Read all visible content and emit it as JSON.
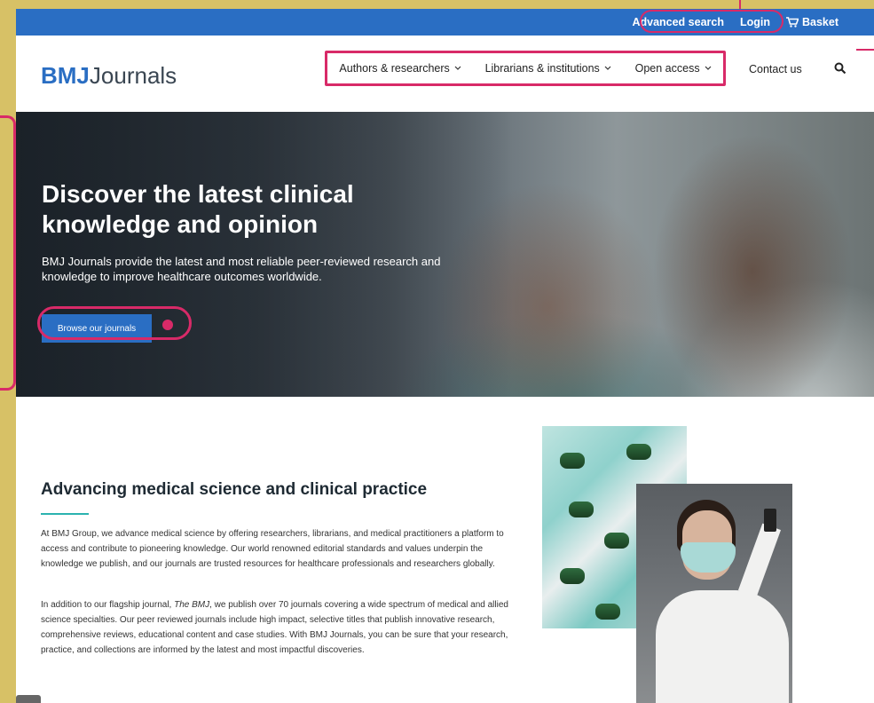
{
  "topbar": {
    "advanced_search": "Advanced search",
    "login": "Login",
    "basket": "Basket"
  },
  "header": {
    "logo_bold": "BMJ",
    "logo_rest": "Journals",
    "nav": [
      {
        "label": "Authors & researchers"
      },
      {
        "label": "Librarians & institutions"
      },
      {
        "label": "Open access"
      }
    ],
    "contact": "Contact us",
    "search_icon": "search-icon"
  },
  "hero": {
    "title": "Discover the latest clinical knowledge and opinion",
    "subtitle": "BMJ Journals provide the latest and most reliable peer-reviewed research and knowledge to improve healthcare outcomes worldwide.",
    "cta": "Browse our journals"
  },
  "section": {
    "title": "Advancing medical science and clinical practice",
    "para1": "At BMJ Group, we advance medical science by offering researchers, librarians, and medical practitioners a platform to access and contribute to pioneering knowledge. Our world renowned editorial standards and values underpin the knowledge we publish, and our journals are trusted resources for healthcare professionals and researchers globally.",
    "para2_a": "In addition to our flagship journal, ",
    "para2_em": "The BMJ",
    "para2_b": ", we publish over 70 journals covering a wide spectrum of medical and allied science specialties. Our peer reviewed journals include high impact, selective titles that publish innovative research, comprehensive reviews, educational content and case studies. With BMJ Journals, you can be sure that your research, practice, and collections are informed by the latest and most impactful discoveries."
  },
  "colors": {
    "brand_blue": "#2a6ec3",
    "highlight_pink": "#d82a68",
    "accent_teal": "#2bb3b0"
  }
}
